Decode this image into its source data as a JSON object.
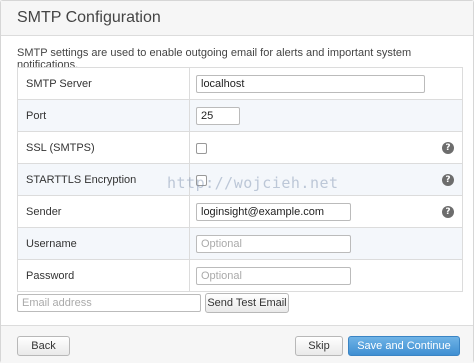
{
  "header": {
    "title": "SMTP Configuration"
  },
  "description": "SMTP settings are used to enable outgoing email for alerts and important system notifications.",
  "fields": {
    "smtp_server": {
      "label": "SMTP Server",
      "value": "localhost"
    },
    "port": {
      "label": "Port",
      "value": "25"
    },
    "ssl": {
      "label": "SSL (SMTPS)",
      "checked": false,
      "help_icon": "question-mark-icon"
    },
    "starttls": {
      "label": "STARTTLS Encryption",
      "checked": false,
      "help_icon": "question-mark-icon"
    },
    "sender": {
      "label": "Sender",
      "value": "loginsight@example.com",
      "help_icon": "question-mark-icon"
    },
    "username": {
      "label": "Username",
      "value": "",
      "placeholder": "Optional"
    },
    "password": {
      "label": "Password",
      "value": "",
      "placeholder": "Optional"
    }
  },
  "test_email": {
    "placeholder": "Email address",
    "button_label": "Send Test Email"
  },
  "footer": {
    "back_label": "Back",
    "skip_label": "Skip",
    "continue_label": "Save and Continue"
  },
  "help_glyph": "?",
  "watermark": "http://wojcieh.net",
  "colors": {
    "primary_button": "#4a9ad8",
    "alt_row": "#f4f7fb",
    "help_icon": "#6d6d6d"
  }
}
